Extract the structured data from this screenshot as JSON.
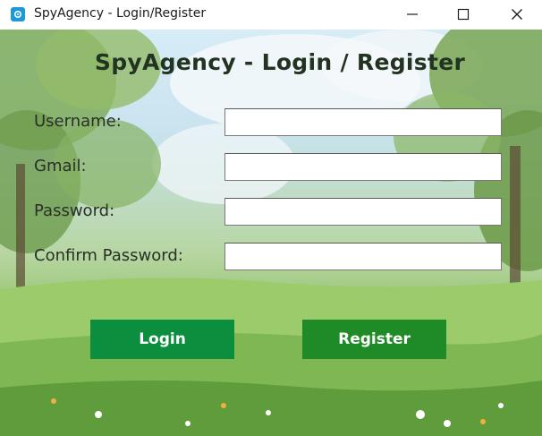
{
  "window": {
    "title": "SpyAgency - Login/Register",
    "icon": "gear-icon",
    "controls": {
      "minimize": "minimize-icon",
      "maximize": "maximize-icon",
      "close": "close-icon"
    }
  },
  "form": {
    "heading": "SpyAgency - Login / Register",
    "fields": [
      {
        "label": "Username:",
        "value": ""
      },
      {
        "label": "Gmail:",
        "value": ""
      },
      {
        "label": "Password:",
        "value": ""
      },
      {
        "label": "Confirm Password:",
        "value": ""
      }
    ],
    "buttons": {
      "login": "Login",
      "register": "Register"
    }
  },
  "colors": {
    "login_button": "#0b8f3e",
    "register_button": "#1f8b26",
    "heading_text": "#223322"
  }
}
